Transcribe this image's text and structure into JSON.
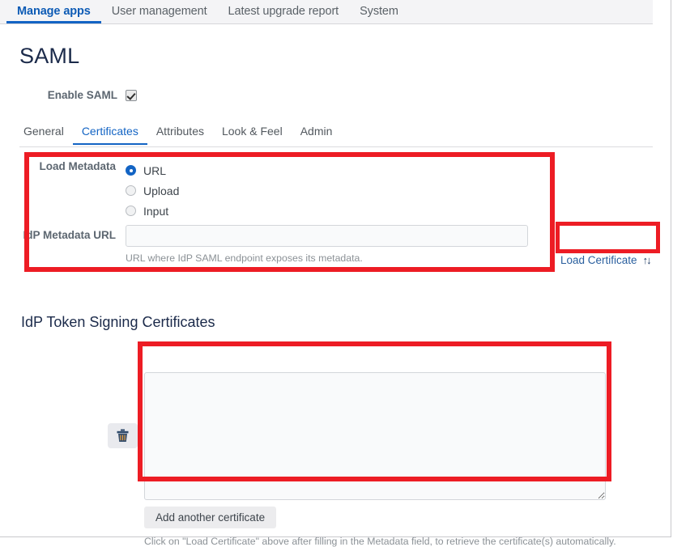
{
  "top_tabs": [
    {
      "label": "Manage apps",
      "active": true
    },
    {
      "label": "User management",
      "active": false
    },
    {
      "label": "Latest upgrade report",
      "active": false
    },
    {
      "label": "System",
      "active": false
    }
  ],
  "page_title": "SAML",
  "enable_saml": {
    "label": "Enable SAML",
    "checked": true
  },
  "sub_tabs": [
    {
      "label": "General",
      "active": false
    },
    {
      "label": "Certificates",
      "active": true
    },
    {
      "label": "Attributes",
      "active": false
    },
    {
      "label": "Look & Feel",
      "active": false
    },
    {
      "label": "Admin",
      "active": false
    }
  ],
  "load_metadata": {
    "label": "Load Metadata",
    "options": [
      {
        "label": "URL",
        "selected": true
      },
      {
        "label": "Upload",
        "selected": false
      },
      {
        "label": "Input",
        "selected": false
      }
    ]
  },
  "idp_metadata_url": {
    "label": "IdP Metadata URL",
    "value": "",
    "placeholder": "",
    "hint": "URL where IdP SAML endpoint exposes its metadata."
  },
  "load_certificate": {
    "label": "Load Certificate",
    "icon": "up-down-arrows-icon",
    "glyph": "↑↓"
  },
  "certificates_section": {
    "heading": "IdP Token Signing Certificates",
    "delete_icon": "trash-icon",
    "certificate_value": "",
    "certificate_placeholder": "",
    "add_button": "Add another certificate",
    "hint": "Click on \"Load Certificate\" above after filling in the Metadata field, to retrieve the certificate(s) automatically."
  },
  "colors": {
    "annotation": "#ed1c24",
    "accent": "#1364c4",
    "link": "#2a5f9e",
    "heading": "#1b2a4a",
    "label": "#5c6670",
    "hint": "#8b9196"
  }
}
